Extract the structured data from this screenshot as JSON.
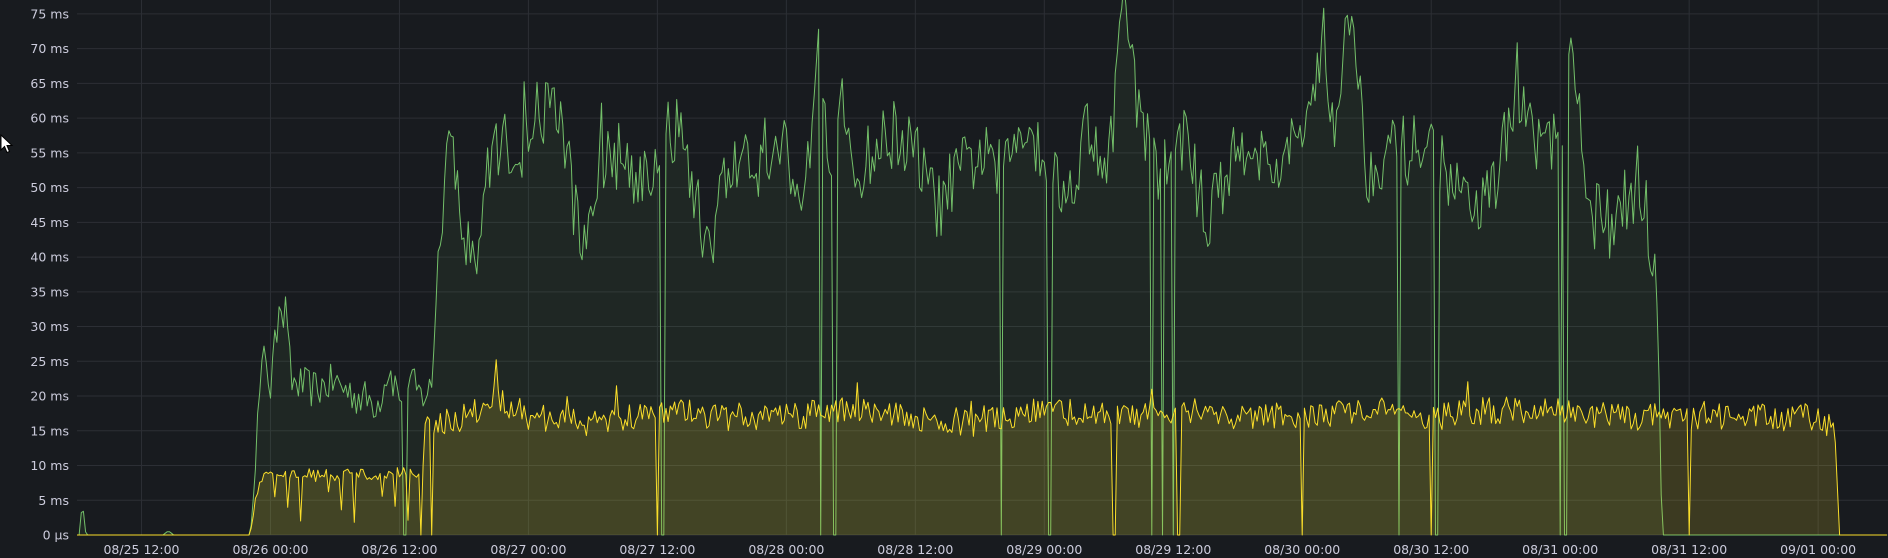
{
  "chart_data": {
    "type": "area",
    "title": "",
    "xlabel": "",
    "ylabel": "",
    "y_unit": "ms",
    "ylim": [
      0,
      77
    ],
    "y_ticks": [
      {
        "value": 0,
        "label": "0 µs"
      },
      {
        "value": 5,
        "label": "5 ms"
      },
      {
        "value": 10,
        "label": "10 ms"
      },
      {
        "value": 15,
        "label": "15 ms"
      },
      {
        "value": 20,
        "label": "20 ms"
      },
      {
        "value": 25,
        "label": "25 ms"
      },
      {
        "value": 30,
        "label": "30 ms"
      },
      {
        "value": 35,
        "label": "35 ms"
      },
      {
        "value": 40,
        "label": "40 ms"
      },
      {
        "value": 45,
        "label": "45 ms"
      },
      {
        "value": 50,
        "label": "50 ms"
      },
      {
        "value": 55,
        "label": "55 ms"
      },
      {
        "value": 60,
        "label": "60 ms"
      },
      {
        "value": 65,
        "label": "65 ms"
      },
      {
        "value": 70,
        "label": "70 ms"
      },
      {
        "value": 75,
        "label": "75 ms"
      }
    ],
    "xlim": [
      "08/25 06:00",
      "09/01 06:30"
    ],
    "x_ticks": [
      "08/25 12:00",
      "08/26 00:00",
      "08/26 12:00",
      "08/27 00:00",
      "08/27 12:00",
      "08/28 00:00",
      "08/28 12:00",
      "08/29 00:00",
      "08/29 12:00",
      "08/30 00:00",
      "08/30 12:00",
      "08/31 00:00",
      "08/31 12:00",
      "09/01 00:00"
    ],
    "grid": true,
    "legend": "none",
    "series": [
      {
        "color": "#73bf69",
        "points": [
          [
            "08/25 06:00",
            0
          ],
          [
            "08/25 06:20",
            1.5
          ],
          [
            "08/25 07:00",
            0
          ],
          [
            "08/25 14:00",
            0
          ],
          [
            "08/25 14:30",
            0.6
          ],
          [
            "08/25 15:00",
            0
          ],
          [
            "08/25 21:00",
            0
          ],
          [
            "08/25 22:00",
            0
          ],
          [
            "08/25 23:00",
            20
          ],
          [
            "08/25 23:30",
            27
          ],
          [
            "08/26 00:00",
            21
          ],
          [
            "08/26 01:00",
            35.5
          ],
          [
            "08/26 02:00",
            22
          ],
          [
            "08/26 04:00",
            21
          ],
          [
            "08/26 06:00",
            22
          ],
          [
            "08/26 08:00",
            20
          ],
          [
            "08/26 10:00",
            19
          ],
          [
            "08/26 11:00",
            24
          ],
          [
            "08/26 12:00",
            20
          ],
          [
            "08/26 13:00",
            22
          ],
          [
            "08/26 14:00",
            20
          ],
          [
            "08/26 15:00",
            21
          ],
          [
            "08/26 15:30",
            38
          ],
          [
            "08/26 16:00",
            45
          ],
          [
            "08/26 16:30",
            57
          ],
          [
            "08/26 18:00",
            45
          ],
          [
            "08/26 19:00",
            38
          ],
          [
            "08/26 20:00",
            50
          ],
          [
            "08/26 21:00",
            57
          ],
          [
            "08/26 23:00",
            55
          ],
          [
            "08/27 01:00",
            57
          ],
          [
            "08/27 02:00",
            64
          ],
          [
            "08/27 03:00",
            60
          ],
          [
            "08/27 04:00",
            50
          ],
          [
            "08/27 05:00",
            41
          ],
          [
            "08/27 06:00",
            50
          ],
          [
            "08/27 08:00",
            55
          ],
          [
            "08/27 10:00",
            52
          ],
          [
            "08/27 12:00",
            53
          ],
          [
            "08/27 14:00",
            59
          ],
          [
            "08/27 16:00",
            45
          ],
          [
            "08/27 17:00",
            42
          ],
          [
            "08/27 18:00",
            50
          ],
          [
            "08/27 20:00",
            55
          ],
          [
            "08/27 22:00",
            53
          ],
          [
            "08/28 00:00",
            57
          ],
          [
            "08/28 01:00",
            48
          ],
          [
            "08/28 02:00",
            52
          ],
          [
            "08/28 03:00",
            77
          ],
          [
            "08/28 04:00",
            54
          ],
          [
            "08/28 05:00",
            65
          ],
          [
            "08/28 06:00",
            51
          ],
          [
            "08/28 08:00",
            55
          ],
          [
            "08/28 10:00",
            58
          ],
          [
            "08/28 12:00",
            55
          ],
          [
            "08/28 14:00",
            47
          ],
          [
            "08/28 16:00",
            52
          ],
          [
            "08/28 18:00",
            55
          ],
          [
            "08/28 20:00",
            52
          ],
          [
            "08/28 22:00",
            60
          ],
          [
            "08/29 00:00",
            55
          ],
          [
            "08/29 02:00",
            48
          ],
          [
            "08/29 04:00",
            59
          ],
          [
            "08/29 06:00",
            53
          ],
          [
            "08/29 07:30",
            78
          ],
          [
            "08/29 09:00",
            58
          ],
          [
            "08/29 11:00",
            52
          ],
          [
            "08/29 13:00",
            58
          ],
          [
            "08/29 15:00",
            45
          ],
          [
            "08/29 17:00",
            52
          ],
          [
            "08/29 19:00",
            58
          ],
          [
            "08/29 21:00",
            52
          ],
          [
            "08/30 00:00",
            57
          ],
          [
            "08/30 02:00",
            73
          ],
          [
            "08/30 03:00",
            55
          ],
          [
            "08/30 04:30",
            78
          ],
          [
            "08/30 06:00",
            52
          ],
          [
            "08/30 08:00",
            56
          ],
          [
            "08/30 10:00",
            55
          ],
          [
            "08/30 12:00",
            57
          ],
          [
            "08/30 14:00",
            50
          ],
          [
            "08/30 16:00",
            45
          ],
          [
            "08/30 18:00",
            52
          ],
          [
            "08/30 20:00",
            62
          ],
          [
            "08/30 22:00",
            57
          ],
          [
            "08/31 00:00",
            55
          ],
          [
            "08/31 01:00",
            68
          ],
          [
            "08/31 02:00",
            58
          ],
          [
            "08/31 03:00",
            45
          ],
          [
            "08/31 04:00",
            48
          ],
          [
            "08/31 05:00",
            42
          ],
          [
            "08/31 06:00",
            48
          ],
          [
            "08/31 07:00",
            46
          ],
          [
            "08/31 08:00",
            49
          ],
          [
            "08/31 08:30",
            38
          ],
          [
            "08/31 09:00",
            35
          ],
          [
            "08/31 09:30",
            0
          ],
          [
            "09/01 06:30",
            0
          ]
        ],
        "dips_to_zero": [
          "08/26 12:30",
          "08/27 12:30",
          "08/28 03:15",
          "08/28 04:30",
          "08/28 20:00",
          "08/29 00:30",
          "08/29 10:00",
          "08/29 11:00",
          "08/29 12:00",
          "08/30 09:00",
          "08/30 12:30",
          "08/31 00:00",
          "08/31 00:30"
        ]
      },
      {
        "color": "#fade2a",
        "points": [
          [
            "08/25 06:00",
            0
          ],
          [
            "08/25 22:00",
            0
          ],
          [
            "08/25 23:00",
            8
          ],
          [
            "08/26 00:00",
            9
          ],
          [
            "08/26 02:00",
            8.5
          ],
          [
            "08/26 04:00",
            9
          ],
          [
            "08/26 06:00",
            8.5
          ],
          [
            "08/26 08:00",
            9
          ],
          [
            "08/26 10:00",
            8.5
          ],
          [
            "08/26 12:00",
            9
          ],
          [
            "08/26 14:00",
            8.5
          ],
          [
            "08/26 14:30",
            16
          ],
          [
            "08/26 18:00",
            17
          ],
          [
            "08/26 21:00",
            20
          ],
          [
            "08/27 00:00",
            17
          ],
          [
            "08/27 06:00",
            16
          ],
          [
            "08/27 12:00",
            18
          ],
          [
            "08/27 18:00",
            17
          ],
          [
            "08/28 00:00",
            17
          ],
          [
            "08/28 06:00",
            18
          ],
          [
            "08/28 12:00",
            17
          ],
          [
            "08/28 18:00",
            16
          ],
          [
            "08/29 00:00",
            18
          ],
          [
            "08/29 06:00",
            17
          ],
          [
            "08/29 12:00",
            18
          ],
          [
            "08/29 18:00",
            17
          ],
          [
            "08/30 00:00",
            17
          ],
          [
            "08/30 06:00",
            18
          ],
          [
            "08/30 12:00",
            17
          ],
          [
            "08/30 18:00",
            18
          ],
          [
            "08/31 00:00",
            18
          ],
          [
            "08/31 06:00",
            17
          ],
          [
            "08/31 12:00",
            17
          ],
          [
            "08/31 18:00",
            17
          ],
          [
            "09/01 00:00",
            17
          ],
          [
            "09/01 01:30",
            15
          ],
          [
            "09/01 02:00",
            0
          ],
          [
            "09/01 06:30",
            0
          ]
        ],
        "sawtooth_between": [
          "08/25 23:00",
          "08/26 14:30"
        ],
        "dips_to_zero": [
          "08/26 15:00",
          "08/27 12:00",
          "08/29 06:30",
          "08/29 12:30",
          "08/30 00:00",
          "08/30 12:00",
          "08/31 12:00"
        ]
      }
    ]
  },
  "cursor": {
    "icon": "mouse-pointer-icon"
  }
}
